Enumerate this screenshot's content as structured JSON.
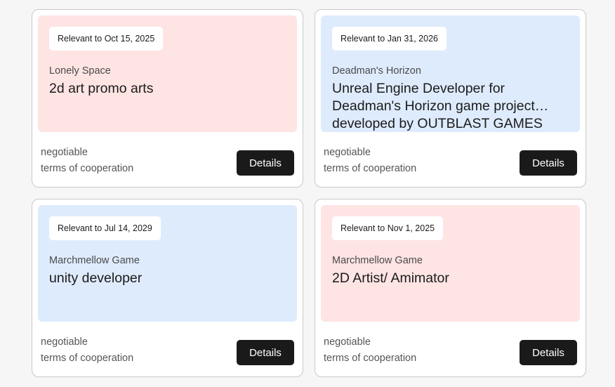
{
  "colors": {
    "pink": "#fee4e3",
    "blue": "#deebfd",
    "button": "#1a1a1a",
    "page_background": "#f6f6f6"
  },
  "cards": [
    {
      "badge": "Relevant to Oct 15, 2025",
      "company": "Lonely Space",
      "title": "2d art promo arts",
      "price": "negotiable",
      "terms": "terms of cooperation",
      "button": "Details",
      "tint": "pink"
    },
    {
      "badge": "Relevant to Jan 31, 2026",
      "company": "Deadman's Horizon",
      "title": "Unreal Engine Developer for Deadman's Horizon game project… developed by OUTBLAST GAMES",
      "price": "negotiable",
      "terms": "terms of cooperation",
      "button": "Details",
      "tint": "blue"
    },
    {
      "badge": "Relevant to Jul 14, 2029",
      "company": "Marchmellow Game",
      "title": "unity developer",
      "price": "negotiable",
      "terms": "terms of cooperation",
      "button": "Details",
      "tint": "blue"
    },
    {
      "badge": "Relevant to Nov 1, 2025",
      "company": "Marchmellow Game",
      "title": "2D Artist/ Amimator",
      "price": "negotiable",
      "terms": "terms of cooperation",
      "button": "Details",
      "tint": "pink"
    }
  ]
}
